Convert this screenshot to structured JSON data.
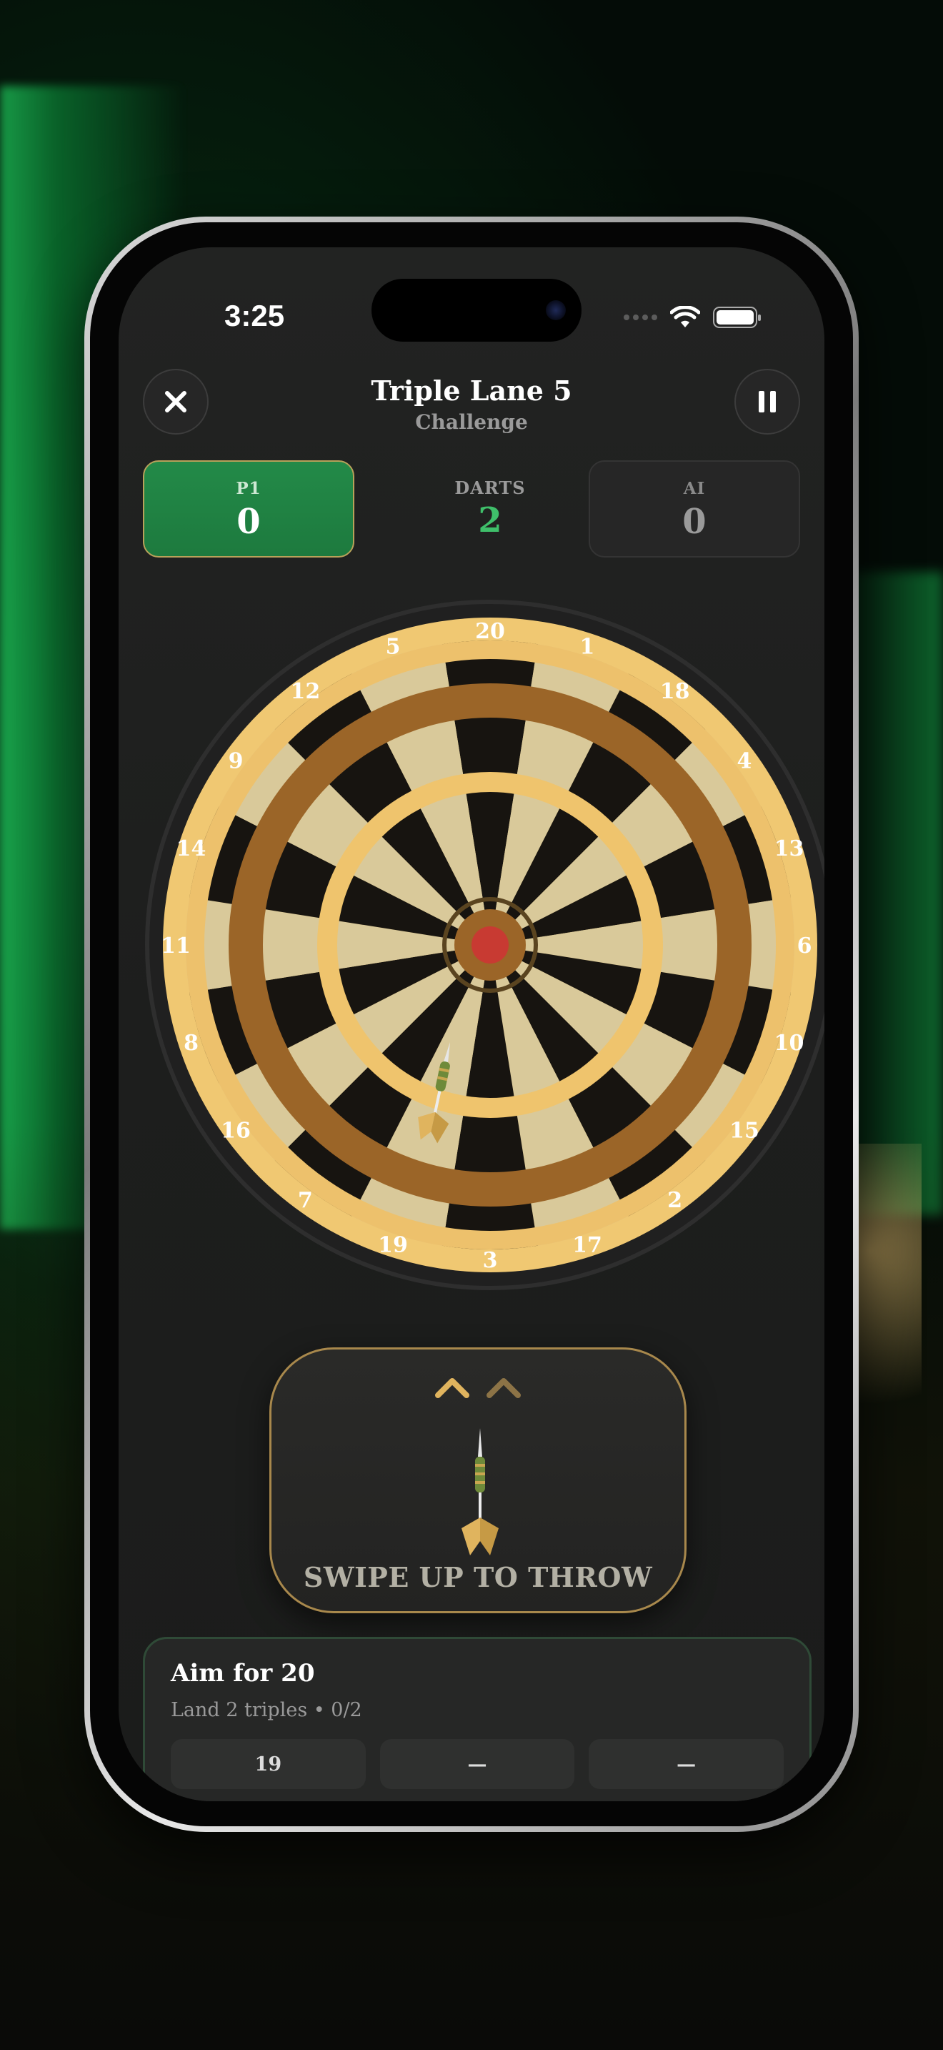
{
  "status": {
    "time": "3:25"
  },
  "header": {
    "title": "Triple Lane 5",
    "subtitle": "Challenge"
  },
  "scoreboard": {
    "p1": {
      "label": "P1",
      "score": "0"
    },
    "darts": {
      "label": "DARTS",
      "value": "2"
    },
    "ai": {
      "label": "AI",
      "score": "0"
    }
  },
  "board": {
    "numbers": [
      "20",
      "1",
      "18",
      "4",
      "13",
      "6",
      "10",
      "15",
      "2",
      "17",
      "3",
      "19",
      "7",
      "16",
      "8",
      "11",
      "14",
      "9",
      "12",
      "5"
    ],
    "colors": {
      "dark_segment": "#171410",
      "light_segment": "#d9c99a",
      "double_ring": "#edc16c",
      "treble_ring_outer": "#9b6528",
      "treble_ring_inner": "#efc46d",
      "bull_outer": "#9b6528",
      "bull_inner": "#c83a32"
    }
  },
  "throw_pad": {
    "label": "SWIPE UP TO THROW"
  },
  "challenge": {
    "title": "Aim for 20",
    "subtitle": "Land 2 triples • 0/2",
    "slots": [
      "19",
      "—",
      "—"
    ]
  },
  "colors": {
    "accent_green": "#238a48",
    "darts_green": "#3fbf6a",
    "gold_border": "#a8884c"
  }
}
